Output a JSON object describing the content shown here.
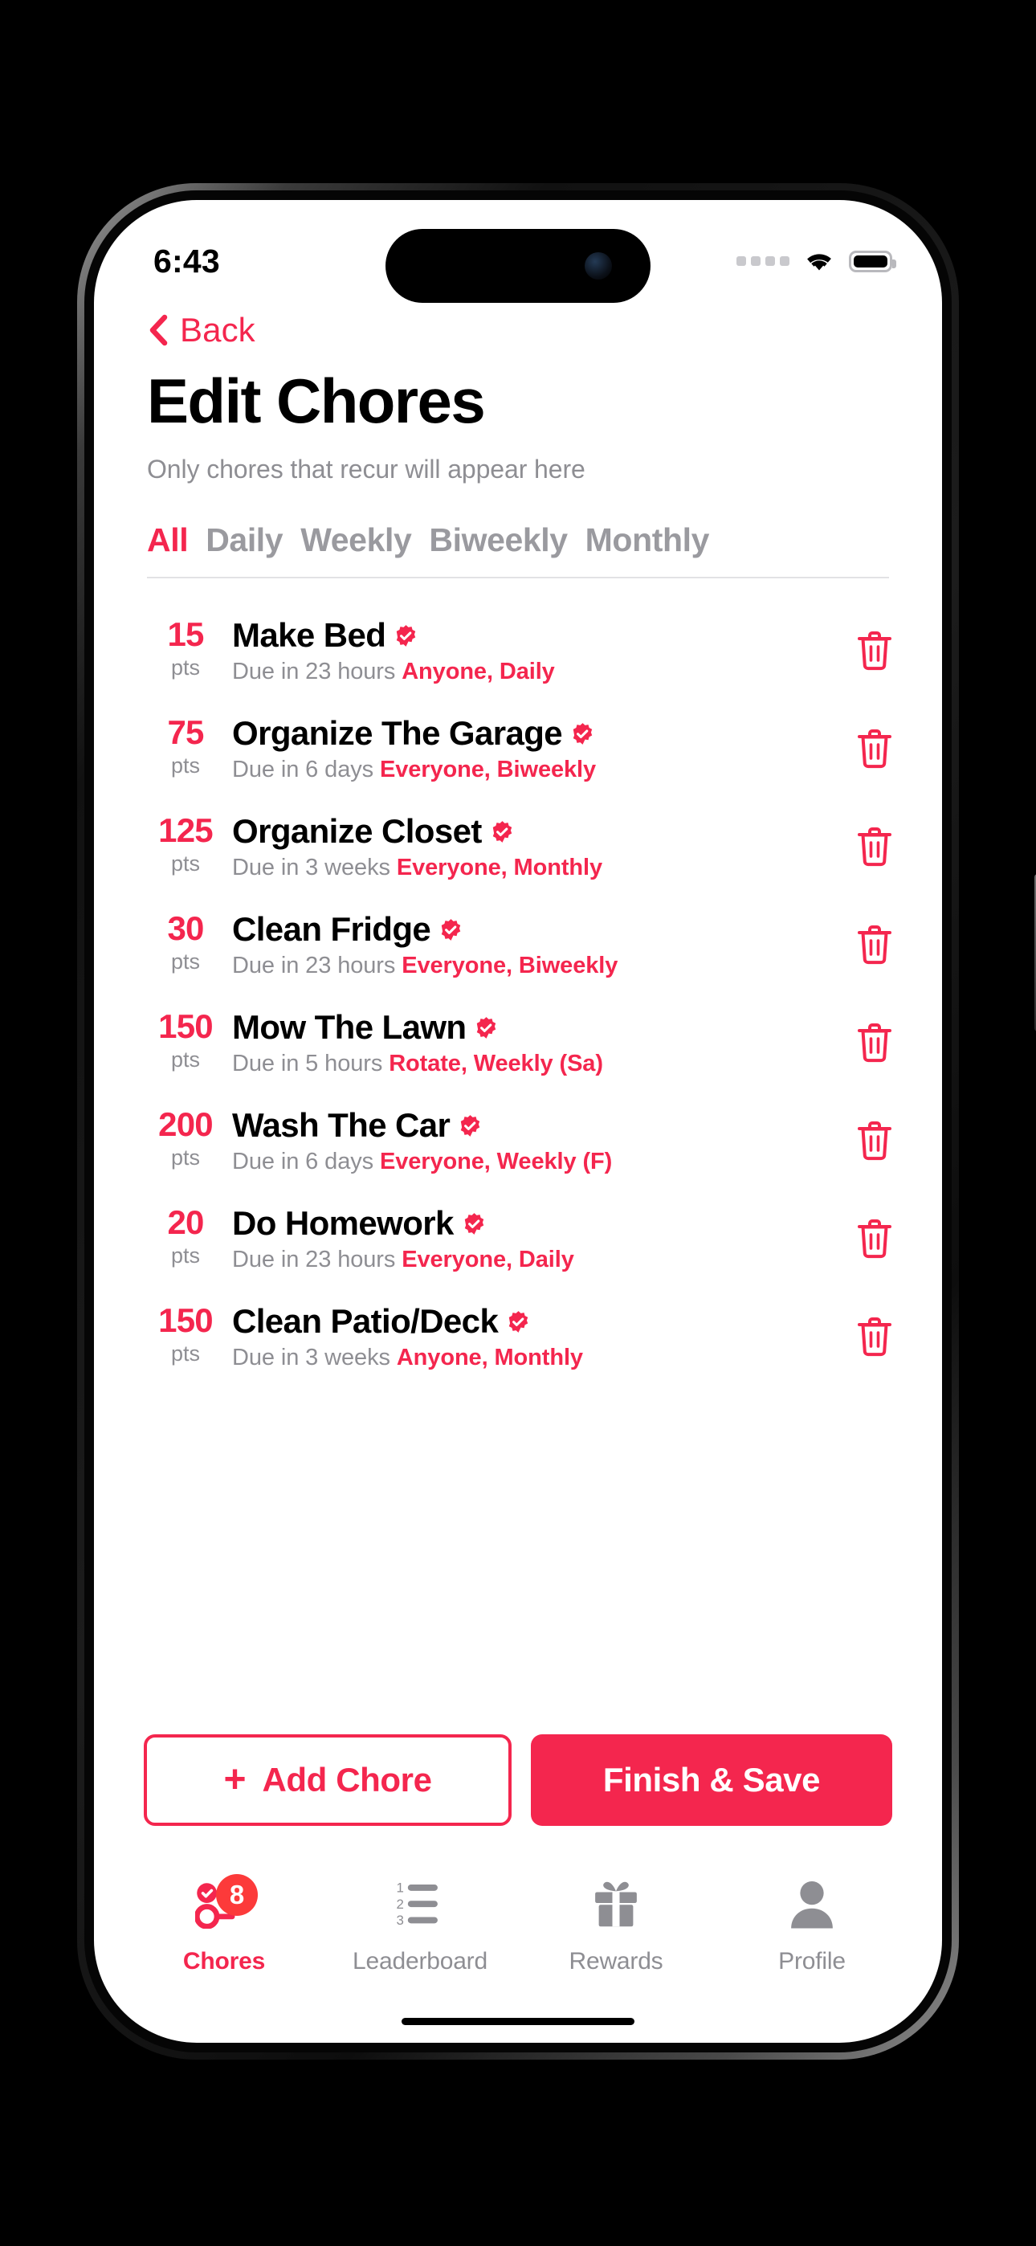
{
  "status_bar": {
    "time": "6:43",
    "cellular_icon": "cellular-dots-icon",
    "wifi_icon": "wifi-icon",
    "battery_icon": "battery-full-icon"
  },
  "nav": {
    "back_icon": "chevron-left-icon",
    "back_label": "Back"
  },
  "header": {
    "title": "Edit Chores",
    "subtitle": "Only chores that recur will appear here"
  },
  "filters": {
    "items": [
      {
        "label": "All",
        "active": true
      },
      {
        "label": "Daily",
        "active": false
      },
      {
        "label": "Weekly",
        "active": false
      },
      {
        "label": "Biweekly",
        "active": false
      },
      {
        "label": "Monthly",
        "active": false
      }
    ]
  },
  "chores": {
    "points_unit": "pts",
    "verified_icon": "verified-badge-icon",
    "delete_icon": "trash-icon",
    "items": [
      {
        "points": "15",
        "title": "Make Bed",
        "due": "Due in 23 hours",
        "tag": "Anyone, Daily"
      },
      {
        "points": "75",
        "title": "Organize The Garage",
        "due": "Due in 6 days",
        "tag": "Everyone, Biweekly"
      },
      {
        "points": "125",
        "title": "Organize Closet",
        "due": "Due in 3 weeks",
        "tag": "Everyone, Monthly"
      },
      {
        "points": "30",
        "title": "Clean Fridge",
        "due": "Due in 23 hours",
        "tag": "Everyone, Biweekly"
      },
      {
        "points": "150",
        "title": "Mow The Lawn",
        "due": "Due in 5 hours",
        "tag": "Rotate, Weekly (Sa)"
      },
      {
        "points": "200",
        "title": "Wash The Car",
        "due": "Due in 6 days",
        "tag": "Everyone, Weekly (F)"
      },
      {
        "points": "20",
        "title": "Do Homework",
        "due": "Due in 23 hours",
        "tag": "Everyone, Daily"
      },
      {
        "points": "150",
        "title": "Clean Patio/Deck",
        "due": "Due in 3 weeks",
        "tag": "Anyone, Monthly"
      }
    ]
  },
  "actions": {
    "add_plus": "+",
    "add_label": "Add Chore",
    "finish_label": "Finish & Save"
  },
  "tabbar": {
    "items": [
      {
        "label": "Chores",
        "icon": "checklist-icon",
        "active": true,
        "badge": "8"
      },
      {
        "label": "Leaderboard",
        "icon": "ranked-list-icon",
        "active": false,
        "badge": ""
      },
      {
        "label": "Rewards",
        "icon": "gift-icon",
        "active": false,
        "badge": ""
      },
      {
        "label": "Profile",
        "icon": "person-icon",
        "active": false,
        "badge": ""
      }
    ]
  },
  "colors": {
    "accent": "#F4264E",
    "badge": "#FC3A3A",
    "muted": "#8E8E93"
  }
}
